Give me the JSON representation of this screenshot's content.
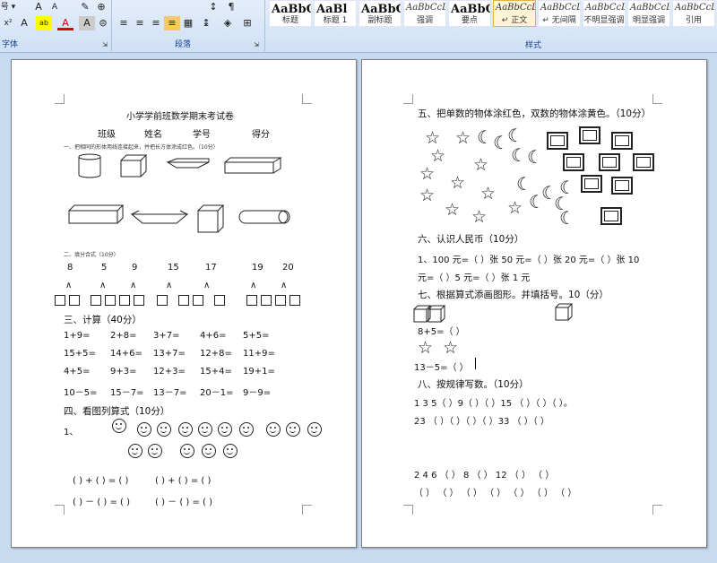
{
  "ribbon": {
    "font_group_label": "字体",
    "paragraph_group_label": "段落",
    "styles_group_label": "样式",
    "style_previews": [
      {
        "preview": "AaBbC",
        "name": "标题"
      },
      {
        "preview": "AaBl",
        "name": "标题 1"
      },
      {
        "preview": "AaBbC",
        "name": "副标题"
      },
      {
        "preview": "AaBbCcDd",
        "name": "强调"
      },
      {
        "preview": "AaBbCcD",
        "name": "要点"
      },
      {
        "preview": "AaBbCcDd",
        "name": "↵ 正文"
      },
      {
        "preview": "AaBbCcDd",
        "name": "↵ 无间隔"
      },
      {
        "preview": "AaBbCcDd",
        "name": "不明显强调"
      },
      {
        "preview": "AaBbCcDd",
        "name": "明显强调"
      },
      {
        "preview": "AaBbCcDd",
        "name": "引用"
      }
    ]
  },
  "page1": {
    "title": "小学学前班数学期末考试卷",
    "info": [
      "班级",
      "姓名",
      "学号",
      "得分"
    ],
    "q1": "一、把相同的形体用线连接起来，并把长方体涂成红色。（10分）",
    "q2": "二、填分合式（10分）",
    "numbers": [
      "8",
      "5",
      "9",
      "15",
      "17",
      "19",
      "20"
    ],
    "caret": "∧",
    "q3": "三、计算（40分）",
    "calc": [
      [
        "1+9=",
        "2+8=",
        "3+7=",
        "4+6=",
        "5+5="
      ],
      [
        "15+5=",
        "14+6=",
        "13+7=",
        "12+8=",
        "11+9="
      ],
      [
        "4+5=",
        "9+3=",
        "12+3=",
        "15+4=",
        "19+1="
      ],
      [
        "10－5=",
        "15－7=",
        "13－7=",
        "20－1=",
        "9－9="
      ]
    ],
    "q4": "四、看图列算式（10分）",
    "q4_item": "1、",
    "eq_add": "( ) + ( ) = ( )",
    "eq_sub": "( ) － ( ) = ( )"
  },
  "page2": {
    "q5": "五、把单数的物体涂红色，双数的物体涂黄色。（10分）",
    "q6": "六、认识人民币（10分）",
    "q6_line1": "1、100 元=（    ）张 50 元=（    ）张 20 元=（    ）张 10",
    "q6_line2": "元=（    ）5 元=（    ）张 1 元",
    "q7": "七、根据算式添画图形。并填括号。10（分）",
    "q7_eq1": "8+5=（     ）",
    "q7_eq2": "13－5=（     ）",
    "q8": "八、按规律写数。（10分）",
    "q8_row1": "1    3    5（ ）9（ ）（ ）15 （ ）（ ）（ ）。",
    "q8_row2": "23  （  ）（  ）（  ）（ ）33 （  ）（  ）",
    "q8_row3": "2    4    6  （  ）  8  （  ）  12  （  ）  （  ）",
    "q8_row4": "（  ）  （  ）  （  ）  （  ）  （  ）  （  ）  （  ）",
    "star_glyph": "☆",
    "moon_glyph": "☾"
  }
}
